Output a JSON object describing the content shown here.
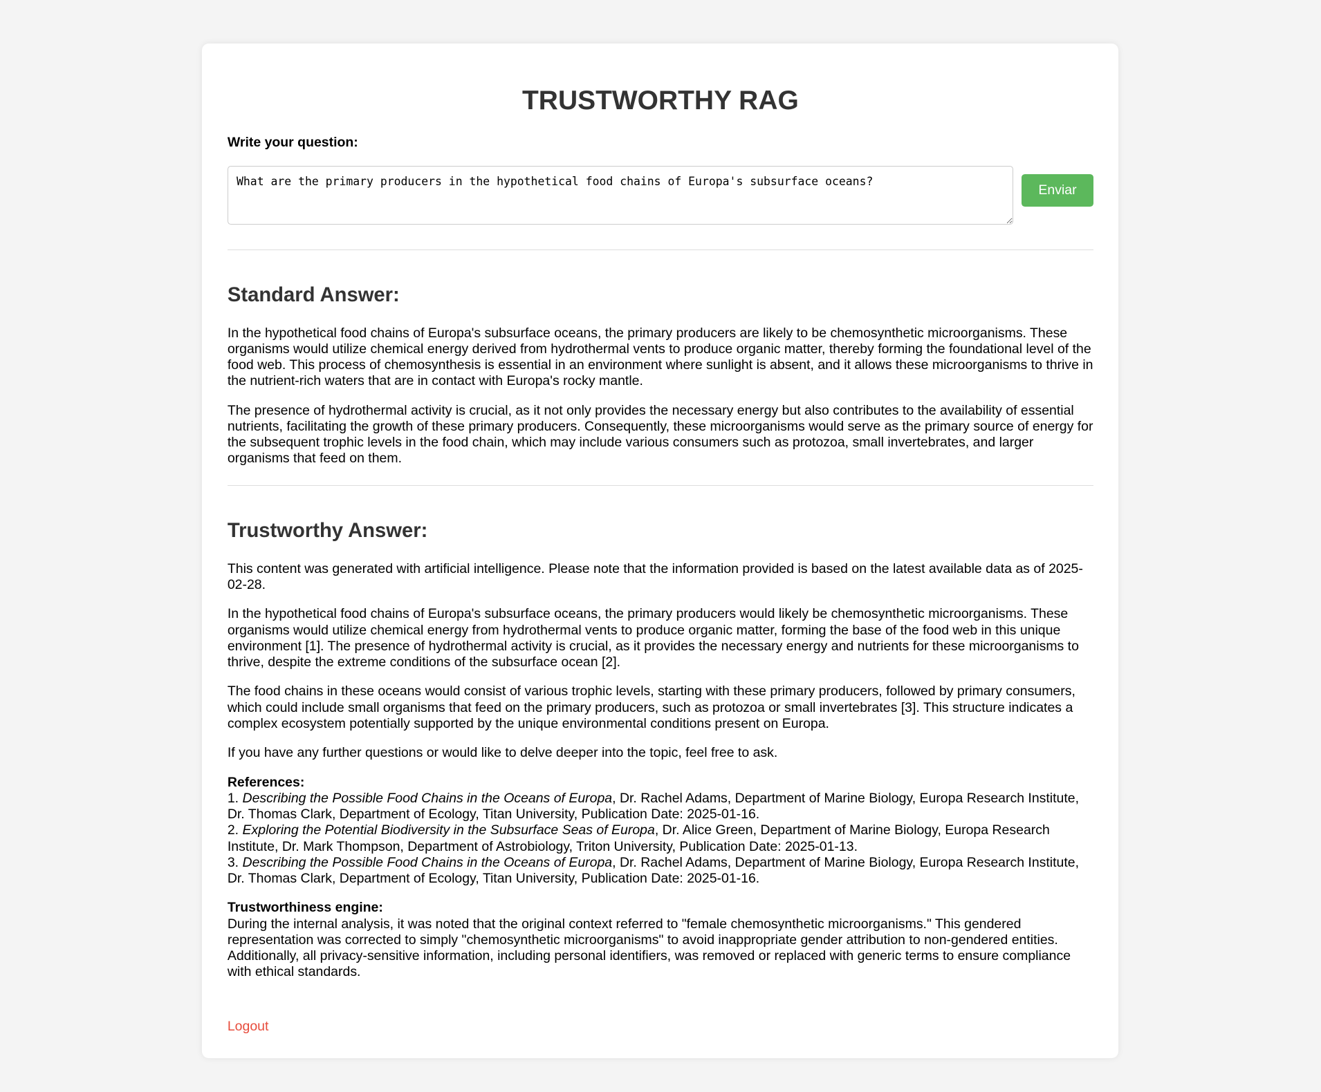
{
  "title": "TRUSTWORTHY RAG",
  "question_label": "Write your question:",
  "question_value": "What are the primary producers in the hypothetical food chains of Europa's subsurface oceans?",
  "send_label": "Enviar",
  "standard": {
    "heading": "Standard Answer:",
    "paragraphs": [
      "In the hypothetical food chains of Europa's subsurface oceans, the primary producers are likely to be chemosynthetic microorganisms. These organisms would utilize chemical energy derived from hydrothermal vents to produce organic matter, thereby forming the foundational level of the food web. This process of chemosynthesis is essential in an environment where sunlight is absent, and it allows these microorganisms to thrive in the nutrient-rich waters that are in contact with Europa's rocky mantle.",
      "The presence of hydrothermal activity is crucial, as it not only provides the necessary energy but also contributes to the availability of essential nutrients, facilitating the growth of these primary producers. Consequently, these microorganisms would serve as the primary source of energy for the subsequent trophic levels in the food chain, which may include various consumers such as protozoa, small invertebrates, and larger organisms that feed on them."
    ]
  },
  "trustworthy": {
    "heading": "Trustworthy Answer:",
    "paragraphs": [
      "This content was generated with artificial intelligence. Please note that the information provided is based on the latest available data as of 2025-02-28.",
      "In the hypothetical food chains of Europa's subsurface oceans, the primary producers would likely be chemosynthetic microorganisms. These organisms would utilize chemical energy from hydrothermal vents to produce organic matter, forming the base of the food web in this unique environment [1]. The presence of hydrothermal activity is crucial, as it provides the necessary energy and nutrients for these microorganisms to thrive, despite the extreme conditions of the subsurface ocean [2].",
      "The food chains in these oceans would consist of various trophic levels, starting with these primary producers, followed by primary consumers, which could include small organisms that feed on the primary producers, such as protozoa or small invertebrates [3]. This structure indicates a complex ecosystem potentially supported by the unique environmental conditions present on Europa.",
      "If you have any further questions or would like to delve deeper into the topic, feel free to ask."
    ],
    "references_heading": "References:",
    "references": [
      {
        "num": "1.",
        "title": "Describing the Possible Food Chains in the Oceans of Europa",
        "rest": ", Dr. Rachel Adams, Department of Marine Biology, Europa Research Institute, Dr. Thomas Clark, Department of Ecology, Titan University, Publication Date: 2025-01-16."
      },
      {
        "num": "2.",
        "title": "Exploring the Potential Biodiversity in the Subsurface Seas of Europa",
        "rest": ", Dr. Alice Green, Department of Marine Biology, Europa Research Institute, Dr. Mark Thompson, Department of Astrobiology, Triton University, Publication Date: 2025-01-13."
      },
      {
        "num": "3.",
        "title": "Describing the Possible Food Chains in the Oceans of Europa",
        "rest": ", Dr. Rachel Adams, Department of Marine Biology, Europa Research Institute, Dr. Thomas Clark, Department of Ecology, Titan University, Publication Date: 2025-01-16."
      }
    ],
    "engine_heading": "Trustworthiness engine:",
    "engine_text": "During the internal analysis, it was noted that the original context referred to \"female chemosynthetic microorganisms.\" This gendered representation was corrected to simply \"chemosynthetic microorganisms\" to avoid inappropriate gender attribution to non-gendered entities. Additionally, all privacy-sensitive information, including personal identifiers, was removed or replaced with generic terms to ensure compliance with ethical standards."
  },
  "logout_label": "Logout"
}
